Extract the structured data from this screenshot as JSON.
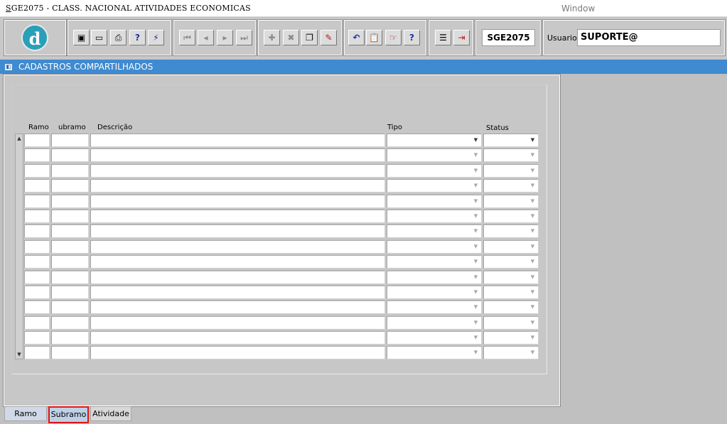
{
  "window": {
    "title": "SGE2075 - CLASS. NACIONAL ATIVIDADES ECONOMICAS",
    "title_mnemonic": "S",
    "title_rest": "GE2075 - CLASS. NACIONAL ATIVIDADES ECONOMICAS",
    "menu_window": "Window"
  },
  "toolbar": {
    "logo_letter": "d",
    "module_code": "SGE2075",
    "user_label": "Usuario",
    "user_value": "SUPORTE@",
    "buttons": [
      {
        "name": "save-icon",
        "glyph": "▣"
      },
      {
        "name": "screen-icon",
        "glyph": "▭"
      },
      {
        "name": "print-icon",
        "glyph": "⎙"
      },
      {
        "name": "query-icon",
        "glyph": "?"
      },
      {
        "name": "execute-query-icon",
        "glyph": "⚡"
      },
      {
        "name": "first-record-icon",
        "glyph": "⏮"
      },
      {
        "name": "previous-record-icon",
        "glyph": "◂"
      },
      {
        "name": "next-record-icon",
        "glyph": "▸"
      },
      {
        "name": "last-record-icon",
        "glyph": "⏭"
      },
      {
        "name": "insert-record-icon",
        "glyph": "✚"
      },
      {
        "name": "delete-record-icon",
        "glyph": "✖"
      },
      {
        "name": "duplicate-record-icon",
        "glyph": "❐"
      },
      {
        "name": "edit-record-icon",
        "glyph": "✎"
      },
      {
        "name": "undo-icon",
        "glyph": "↶"
      },
      {
        "name": "clipboard-icon",
        "glyph": "📋"
      },
      {
        "name": "hand-icon",
        "glyph": "☞"
      },
      {
        "name": "help-icon",
        "glyph": "?"
      },
      {
        "name": "menu-icon",
        "glyph": "☰"
      },
      {
        "name": "exit-icon",
        "glyph": "⇥"
      }
    ]
  },
  "form": {
    "header_title": "CADASTROS COMPARTILHADOS",
    "columns": {
      "ramo": "Ramo",
      "subramo": "ubramo",
      "descricao": "Descrição",
      "tipo": "Tipo",
      "status": "Status"
    },
    "row_count": 15,
    "tabs": [
      {
        "label": "Ramo"
      },
      {
        "label": "Subramo"
      },
      {
        "label": "Atividade"
      }
    ]
  },
  "colors": {
    "header_bar": "#3f8ad0",
    "logo": "#29a0b8",
    "selected_tab_border": "#e01515"
  }
}
